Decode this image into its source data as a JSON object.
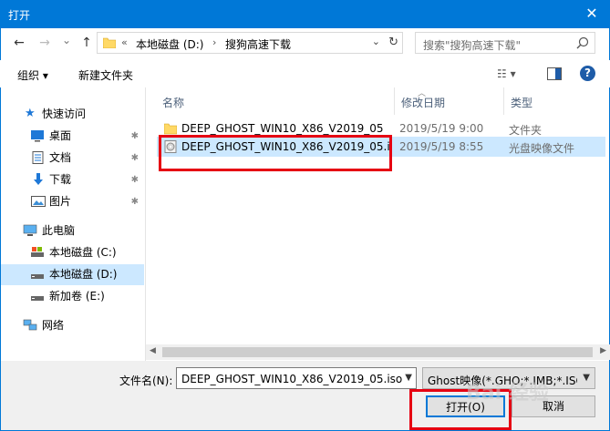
{
  "window": {
    "title": "打开",
    "close_glyph": "✕"
  },
  "nav": {
    "back_glyph": "←",
    "forward_glyph": "→",
    "dropdown_glyph": "⌄",
    "up_glyph": "↑",
    "path": [
      "本地磁盘 (D:)",
      "搜狗高速下载"
    ],
    "path_prefix": "«",
    "path_sep": "›",
    "refresh_glyph": "↻",
    "search_placeholder": "搜索\"搜狗高速下载\""
  },
  "toolbar": {
    "organize": "组织 ▾",
    "new_folder": "新建文件夹",
    "view_glyph": "☷ ▾",
    "help": "?"
  },
  "sidebar": {
    "quick_access": "快速访问",
    "items": [
      "桌面",
      "文档",
      "下载",
      "图片"
    ],
    "this_pc": "此电脑",
    "drives": [
      "本地磁盘 (C:)",
      "本地磁盘 (D:)",
      "新加卷 (E:)"
    ],
    "network": "网络",
    "pin_glyph": "✱"
  },
  "columns": {
    "name": "名称",
    "date": "修改日期",
    "type": "类型"
  },
  "files": [
    {
      "name": "DEEP_GHOST_WIN10_X86_V2019_05",
      "date": "2019/5/19 9:00",
      "type": "文件夹"
    },
    {
      "name": "DEEP_GHOST_WIN10_X86_V2019_05.i...",
      "date": "2019/5/19 8:55",
      "type": "光盘映像文件"
    }
  ],
  "footer": {
    "filename_label": "文件名(N):",
    "filename_value": "DEEP_GHOST_WIN10_X86_V2019_05.iso",
    "type_value": "Ghost映像(*.GHO;*.IMB;*.ISO",
    "open_label": "打开(O)",
    "cancel_label": "取消"
  },
  "watermark": "Bai 经验",
  "colors": {
    "accent": "#0078d7",
    "selection": "#cce8ff",
    "highlight": "#e60012"
  }
}
